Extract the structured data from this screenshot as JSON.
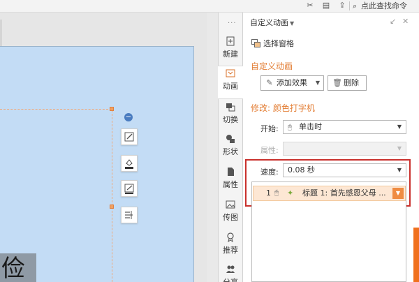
{
  "toolbar": {
    "icons": [
      "tools-icon",
      "document-icon",
      "share-icon"
    ],
    "search_placeholder": "点此查找命令"
  },
  "slide": {
    "visible_title_fragment": "俭"
  },
  "float_tools": [
    "edit-shape-icon",
    "fill-icon",
    "outline-icon",
    "text-format-icon"
  ],
  "sidebar": {
    "tabs": [
      {
        "label": "新建",
        "icon": "new-icon"
      },
      {
        "label": "动画",
        "icon": "animation-icon",
        "active": true
      },
      {
        "label": "切换",
        "icon": "transition-icon"
      },
      {
        "label": "形状",
        "icon": "shape-icon"
      },
      {
        "label": "属性",
        "icon": "properties-icon"
      },
      {
        "label": "传图",
        "icon": "upload-image-icon"
      },
      {
        "label": "推荐",
        "icon": "recommend-icon"
      },
      {
        "label": "分享",
        "icon": "people-icon"
      }
    ]
  },
  "panel": {
    "title": "自定义动画",
    "selection_pane": "选择窗格",
    "custom_animation_heading": "自定义动画",
    "add_effect": "添加效果",
    "delete": "删除",
    "modify_heading": "修改: 颜色打字机",
    "start_label": "开始:",
    "start_value": "单击时",
    "property_label": "属性:",
    "property_value": "",
    "speed_label": "速度:",
    "speed_value": "0.08 秒",
    "animation_list": [
      {
        "order": "1",
        "text": "标题 1: 首先感恩父母 ..."
      }
    ]
  },
  "colors": {
    "accent_orange": "#e37e35",
    "highlight_red": "#c9302c",
    "slide_bg": "#c3dcf5",
    "selected_row": "#fde7d4"
  }
}
